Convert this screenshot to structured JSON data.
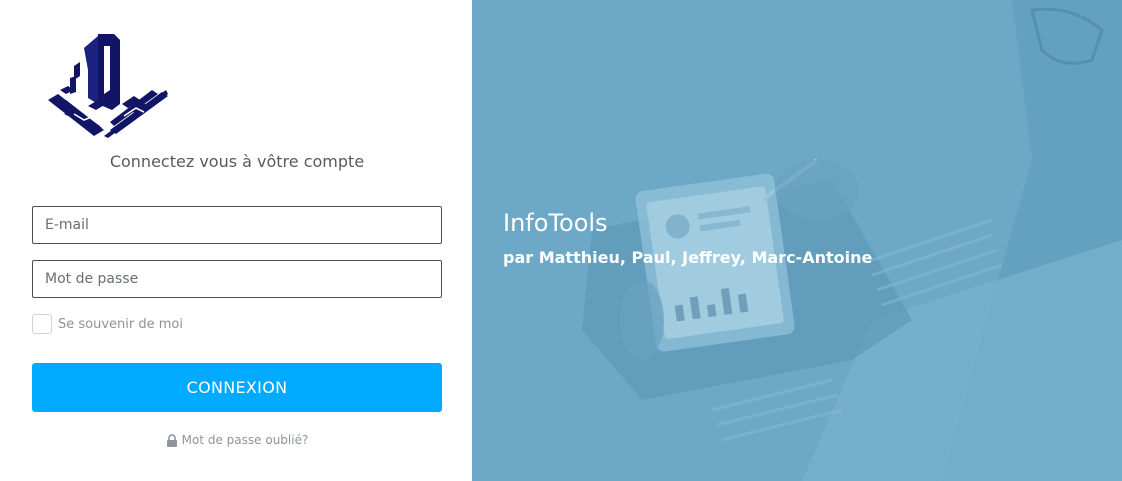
{
  "login": {
    "tagline": "Connectez vous à vôtre compte",
    "email_placeholder": "E-mail",
    "password_placeholder": "Mot de passe",
    "remember_label": "Se souvenir de moi",
    "submit_label": "CONNEXION",
    "forgot_label": "Mot de passe oublié?"
  },
  "brand": {
    "title": "InfoTools",
    "subtitle": "par Matthieu, Paul, Jeffrey, Marc-Antoine"
  },
  "icons": {
    "logo": "building-circuit-logo",
    "forgot": "lock-icon"
  },
  "colors": {
    "accent": "#00aaff",
    "logo": "#121565",
    "panel": "#6ea8c7"
  }
}
